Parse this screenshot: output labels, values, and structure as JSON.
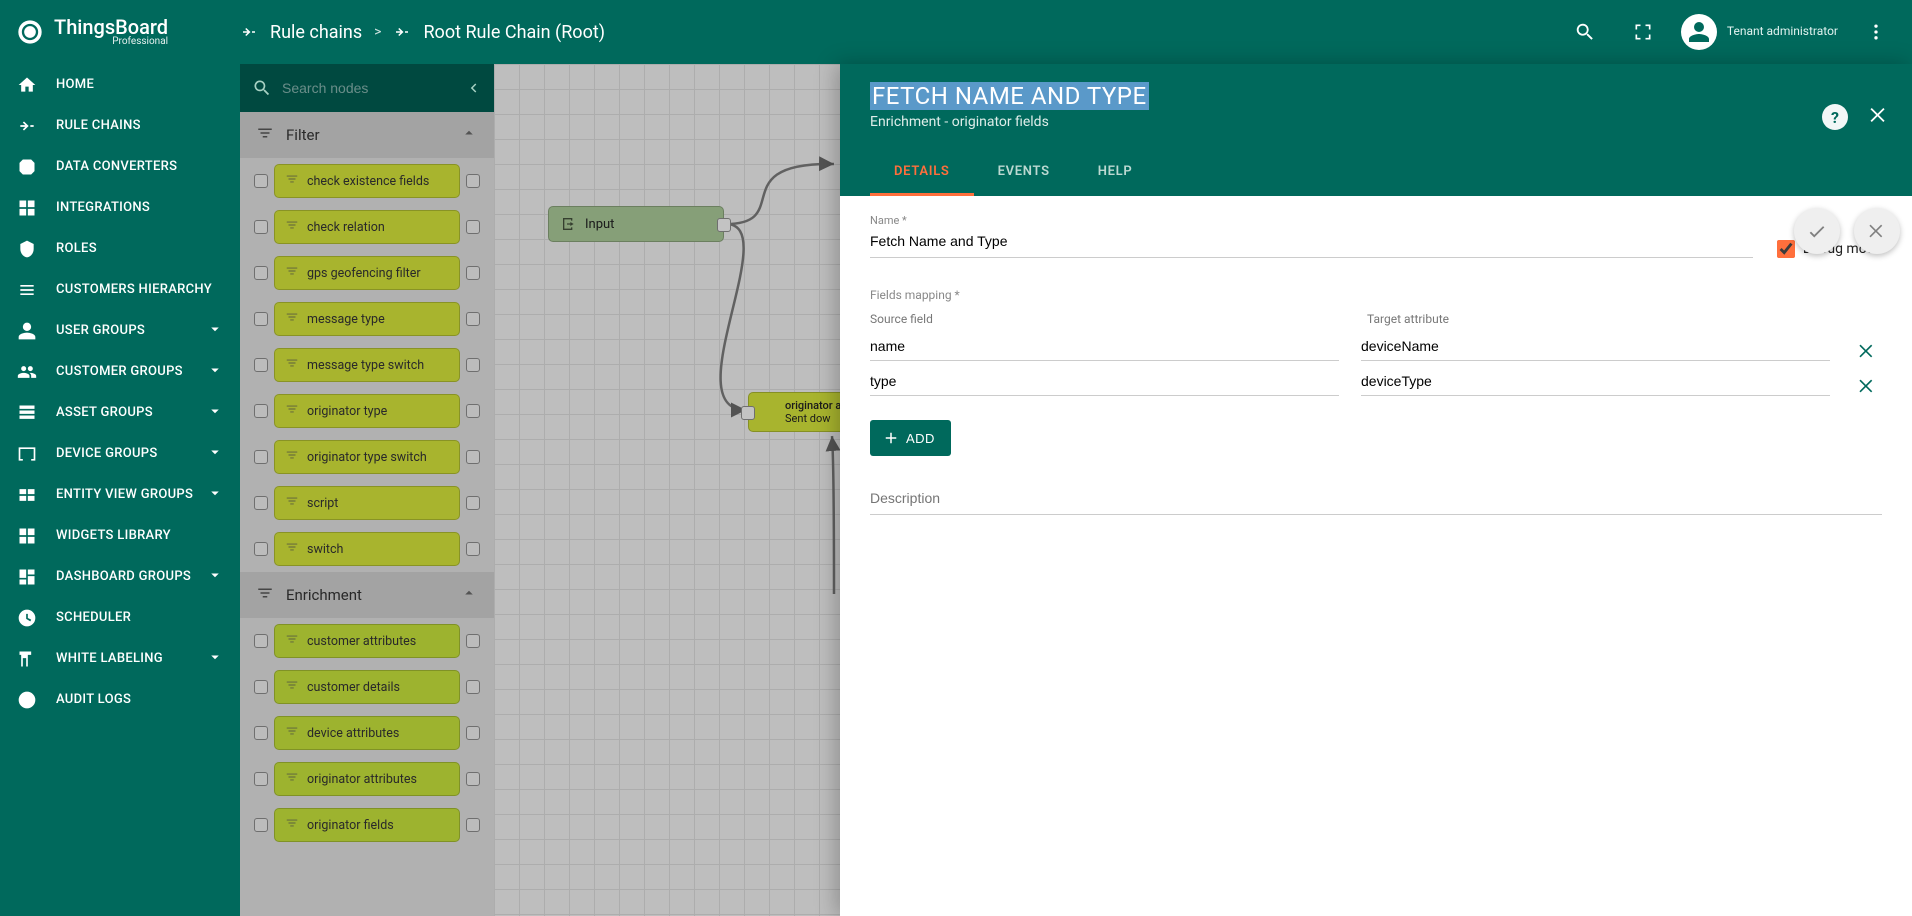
{
  "brand": {
    "name": "ThingsBoard",
    "edition": "Professional"
  },
  "breadcrumb": {
    "parent": "Rule chains",
    "current": "Root Rule Chain (Root)"
  },
  "user": {
    "role": "Tenant administrator"
  },
  "sidebar": [
    {
      "icon": "home",
      "label": "HOME"
    },
    {
      "icon": "rule",
      "label": "RULE CHAINS"
    },
    {
      "icon": "convert",
      "label": "DATA CONVERTERS"
    },
    {
      "icon": "integrations",
      "label": "INTEGRATIONS"
    },
    {
      "icon": "roles",
      "label": "ROLES"
    },
    {
      "icon": "hierarchy",
      "label": "CUSTOMERS HIERARCHY"
    },
    {
      "icon": "user",
      "label": "USER GROUPS",
      "expand": true
    },
    {
      "icon": "customer",
      "label": "CUSTOMER GROUPS",
      "expand": true
    },
    {
      "icon": "asset",
      "label": "ASSET GROUPS",
      "expand": true
    },
    {
      "icon": "device",
      "label": "DEVICE GROUPS",
      "expand": true
    },
    {
      "icon": "entity",
      "label": "ENTITY VIEW GROUPS",
      "expand": true
    },
    {
      "icon": "widgets",
      "label": "WIDGETS LIBRARY"
    },
    {
      "icon": "dashboard",
      "label": "DASHBOARD GROUPS",
      "expand": true
    },
    {
      "icon": "scheduler",
      "label": "SCHEDULER"
    },
    {
      "icon": "label",
      "label": "WHITE LABELING",
      "expand": true
    },
    {
      "icon": "audit",
      "label": "AUDIT LOGS"
    }
  ],
  "palette": {
    "search_placeholder": "Search nodes",
    "groups": [
      {
        "name": "Filter",
        "type": "filter",
        "nodes": [
          "check existence fields",
          "check relation",
          "gps geofencing filter",
          "message type",
          "message type switch",
          "originator type",
          "originator type switch",
          "script",
          "switch"
        ]
      },
      {
        "name": "Enrichment",
        "type": "enrichment",
        "nodes": [
          "customer attributes",
          "customer details",
          "device attributes",
          "originator attributes",
          "originator fields"
        ]
      }
    ]
  },
  "canvas": {
    "input_label": "Input",
    "originator": {
      "line1": "originator a",
      "line2": "Sent dow"
    }
  },
  "panel": {
    "title": "FETCH NAME AND TYPE",
    "subtitle": "Enrichment - originator fields",
    "tabs": {
      "details": "DETAILS",
      "events": "EVENTS",
      "help": "HELP"
    },
    "name_label": "Name *",
    "name_value": "Fetch Name and Type",
    "debug_label": "Debug mode",
    "fields_label": "Fields mapping *",
    "col_source": "Source field",
    "col_target": "Target attribute",
    "rows": [
      {
        "source": "name",
        "target": "deviceName"
      },
      {
        "source": "type",
        "target": "deviceType"
      }
    ],
    "add_label": "ADD",
    "desc_placeholder": "Description"
  }
}
